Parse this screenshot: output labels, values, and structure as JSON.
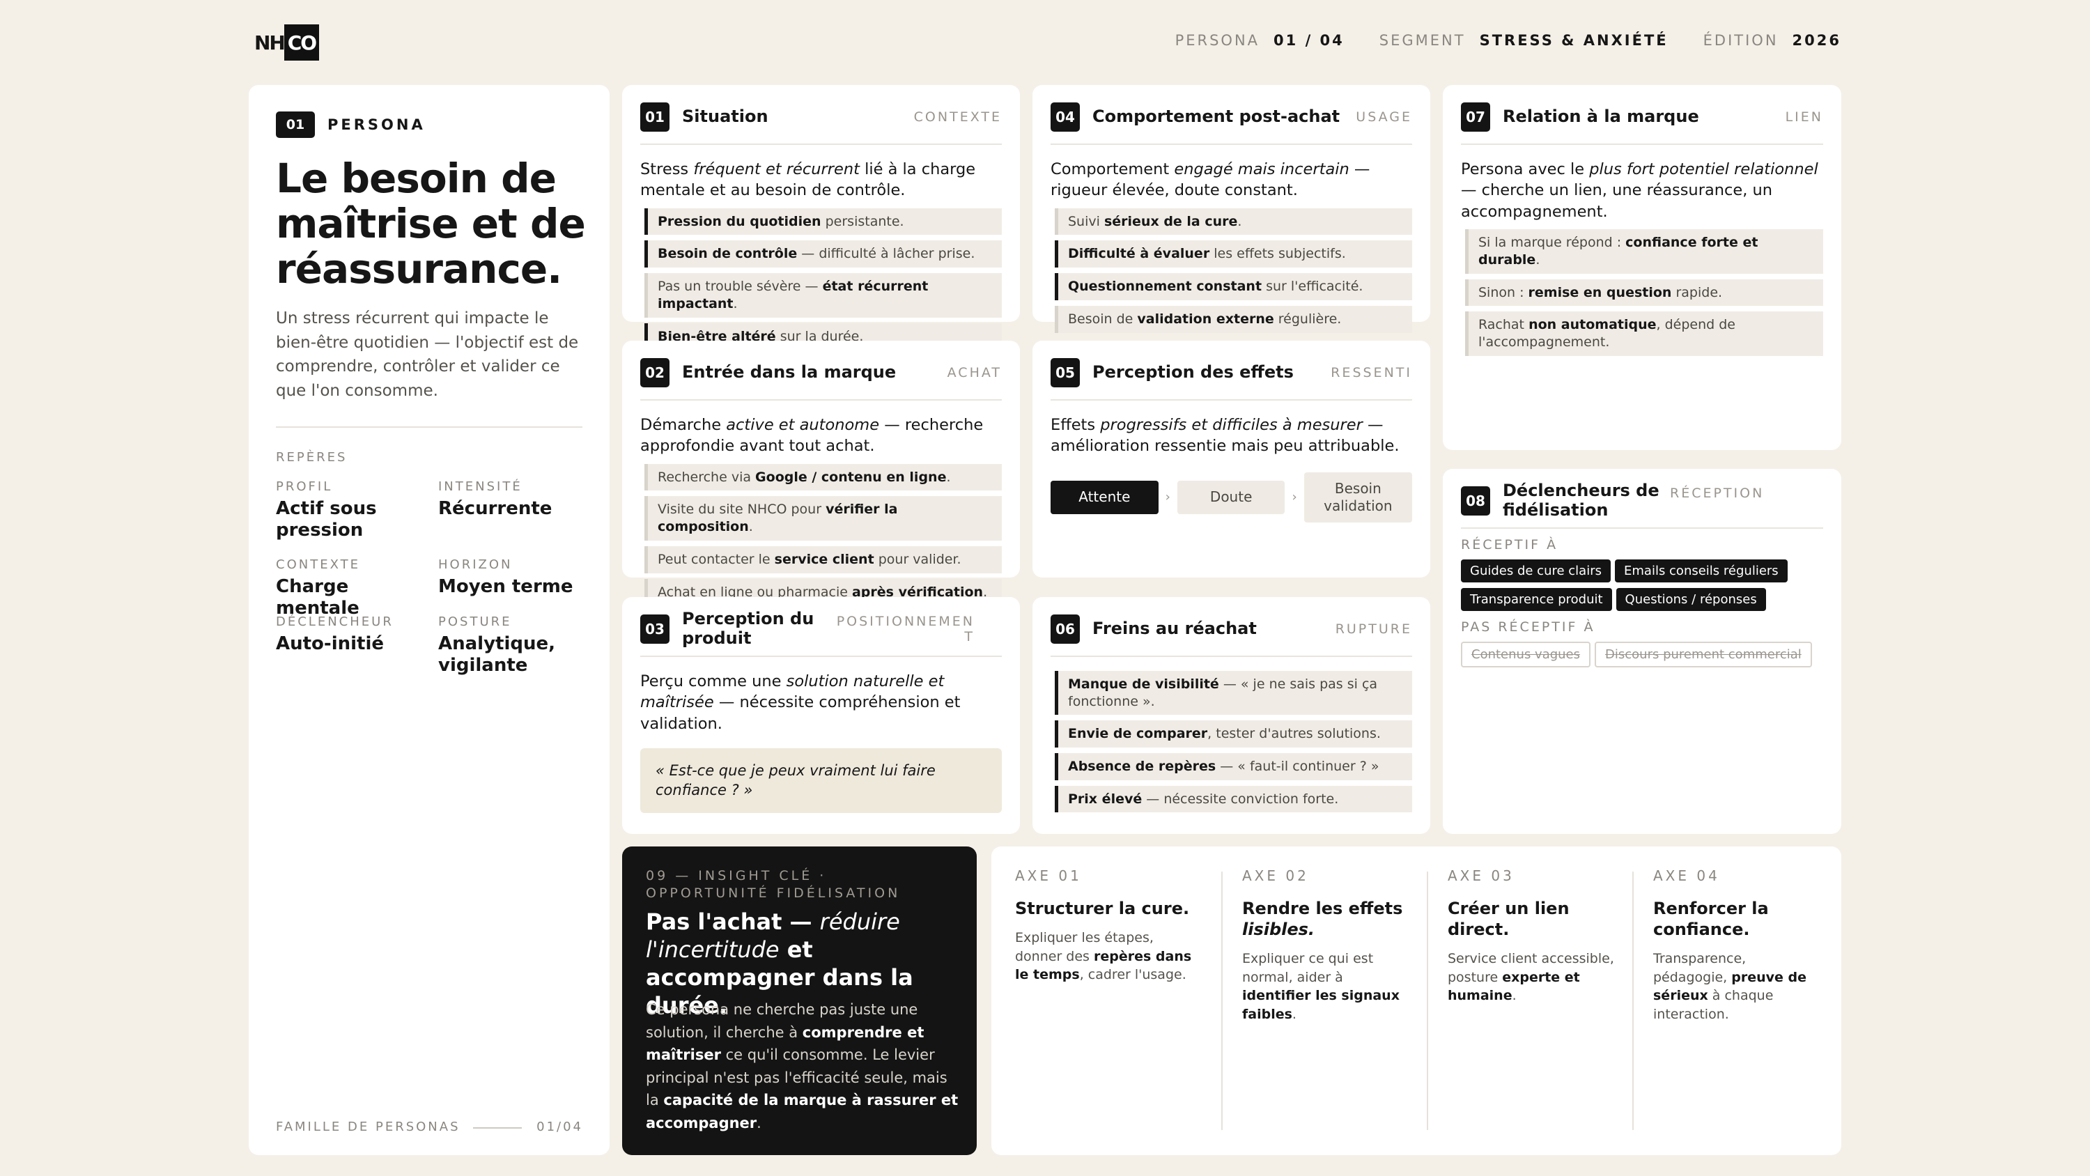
{
  "brand": {
    "logo_left": "NH",
    "logo_right": "CO"
  },
  "meta": {
    "persona_k": "PERSONA",
    "persona_v": "01 / 04",
    "segment_k": "SEGMENT",
    "segment_v": "STRESS & ANXIÉTÉ",
    "edition_k": "ÉDITION",
    "edition_v": "2026"
  },
  "persona": {
    "num": "01",
    "label": "PERSONA",
    "title": "Le besoin de maîtrise et de réassurance.",
    "desc": "Un stress récurrent qui impacte le bien-être quotidien — l'objectif est de comprendre, contrôler et valider ce que l'on consomme.",
    "reperes": "REPÈRES",
    "fields": [
      {
        "k": "PROFIL",
        "v": "Actif sous pression"
      },
      {
        "k": "INTENSITÉ",
        "v": "Récurrente"
      },
      {
        "k": "CONTEXTE",
        "v": "Charge mentale"
      },
      {
        "k": "HORIZON",
        "v": "Moyen terme"
      },
      {
        "k": "DÉCLENCHEUR",
        "v": "Auto-initié"
      },
      {
        "k": "POSTURE",
        "v": "Analytique, vigilante"
      }
    ],
    "footer_k": "FAMILLE DE PERSONAS",
    "footer_v": "01/04"
  },
  "c01": {
    "num": "01",
    "title": "Situation",
    "tag": "CONTEXTE",
    "lead_a": "Stress ",
    "lead_i": "fréquent et récurrent",
    "lead_b": " lié à la charge mentale et au besoin de contrôle.",
    "items": [
      {
        "b": "Pression du quotidien",
        "t": " persistante.",
        "b2": "",
        "t2": ""
      },
      {
        "b": "Besoin de contrôle",
        "t": " — difficulté à lâcher prise.",
        "b2": "",
        "t2": ""
      },
      {
        "b": "",
        "t": "Pas un trouble sévère — ",
        "b2": "état récurrent impactant",
        "t2": "."
      },
      {
        "b": "Bien-être altéré",
        "t": " sur la durée.",
        "b2": "",
        "t2": ""
      }
    ]
  },
  "c02": {
    "num": "02",
    "title": "Entrée dans la marque",
    "tag": "ACHAT",
    "lead_a": "Démarche ",
    "lead_i": "active et autonome",
    "lead_b": " — recherche approfondie avant tout achat.",
    "items": [
      {
        "b": "",
        "t": "Recherche via ",
        "b2": "Google / contenu en ligne",
        "t2": "."
      },
      {
        "b": "",
        "t": "Visite du site NHCO pour ",
        "b2": "vérifier la composition",
        "t2": "."
      },
      {
        "b": "",
        "t": "Peut contacter le ",
        "b2": "service client",
        "t2": " pour valider."
      },
      {
        "b": "",
        "t": "Achat en ligne ou pharmacie ",
        "b2": "après vérification",
        "t2": "."
      }
    ]
  },
  "c03": {
    "num": "03",
    "title": "Perception du produit",
    "tag": "POSITIONNEMENT",
    "lead_a": "Perçu comme une ",
    "lead_i": "solution naturelle et maîtrisée",
    "lead_b": " — nécessite compréhension et validation.",
    "quote": "« Est-ce que je peux vraiment lui faire confiance ? »"
  },
  "c04": {
    "num": "04",
    "title": "Comportement post-achat",
    "tag": "USAGE",
    "lead_a": "Comportement ",
    "lead_i": "engagé mais incertain",
    "lead_b": " — rigueur élevée, doute constant.",
    "items": [
      {
        "b": "",
        "t": "Suivi ",
        "b2": "sérieux de la cure",
        "t2": "."
      },
      {
        "b": "Difficulté à évaluer",
        "t": " les effets subjectifs.",
        "b2": "",
        "t2": ""
      },
      {
        "b": "Questionnement constant",
        "t": " sur l'efficacité.",
        "b2": "",
        "t2": ""
      },
      {
        "b": "",
        "t": "Besoin de ",
        "b2": "validation externe",
        "t2": " régulière."
      }
    ]
  },
  "c05": {
    "num": "05",
    "title": "Perception des effets",
    "tag": "RESSENTI",
    "lead_a": "Effets ",
    "lead_i": "progressifs et difficiles à mesurer",
    "lead_b": " — amélioration ressentie mais peu attribuable.",
    "steps": [
      "Attente",
      "Doute",
      "Besoin validation"
    ],
    "arrow": "›"
  },
  "c06": {
    "num": "06",
    "title": "Freins au réachat",
    "tag": "RUPTURE",
    "items": [
      {
        "b": "Manque de visibilité",
        "t": " — « je ne sais pas si ça fonctionne ».",
        "b2": "",
        "t2": ""
      },
      {
        "b": "Envie de comparer",
        "t": ", tester d'autres solutions.",
        "b2": "",
        "t2": ""
      },
      {
        "b": "Absence de repères",
        "t": " — « faut-il continuer ? »",
        "b2": "",
        "t2": ""
      },
      {
        "b": "Prix élevé",
        "t": " — nécessite conviction forte.",
        "b2": "",
        "t2": ""
      }
    ]
  },
  "c07": {
    "num": "07",
    "title": "Relation à la marque",
    "tag": "LIEN",
    "lead_a": "Persona avec le ",
    "lead_i": "plus fort potentiel relationnel",
    "lead_b": " — cherche un lien, une réassurance, un accompagnement.",
    "items": [
      {
        "b": "",
        "t": "Si la marque répond : ",
        "b2": "confiance forte et durable",
        "t2": "."
      },
      {
        "b": "",
        "t": "Sinon : ",
        "b2": "remise en question",
        "t2": " rapide."
      },
      {
        "b": "",
        "t": "Rachat ",
        "b2": "non automatique",
        "t2": ", dépend de l'accompagnement."
      }
    ]
  },
  "c08": {
    "num": "08",
    "title": "Déclencheurs de fidélisation",
    "tag": "RÉCEPTION",
    "recept_label": "RÉCEPTIF À",
    "recept": [
      "Guides de cure clairs",
      "Emails conseils réguliers",
      "Transparence produit",
      "Questions / réponses"
    ],
    "nonrecept_label": "PAS RÉCEPTIF À",
    "nonrecept": [
      "Contenus vagues",
      "Discours purement commercial"
    ]
  },
  "insight": {
    "kicker": "09 — INSIGHT CLÉ · OPPORTUNITÉ FIDÉLISATION",
    "h_a": "Pas l'achat — ",
    "h_i": "réduire l'incertitude",
    "h_b": " et accompagner dans la durée.",
    "p1": "Ce persona ne cherche pas juste une solution, il cherche à ",
    "p1b": "comprendre et maîtriser",
    "p2": " ce qu'il consomme. Le levier principal n'est pas l'efficacité seule, mais la ",
    "p2b": "capacité de la marque à rassurer et accompagner",
    "p3": "."
  },
  "axes": [
    {
      "k": "AXE 01",
      "t": "Structurer la cure.",
      "ti": "",
      "d1": "Expliquer les étapes, donner des ",
      "db": "repères dans le temps",
      "d2": ", cadrer l'usage."
    },
    {
      "k": "AXE 02",
      "t": "Rendre les effets ",
      "ti": "lisibles.",
      "d1": "Expliquer ce qui est normal, aider à ",
      "db": "identifier les signaux faibles",
      "d2": "."
    },
    {
      "k": "AXE 03",
      "t": "Créer un lien direct.",
      "ti": "",
      "d1": "Service client accessible, posture ",
      "db": "experte et humaine",
      "d2": "."
    },
    {
      "k": "AXE 04",
      "t": "Renforcer la confiance.",
      "ti": "",
      "d1": "Transparence, pédagogie, ",
      "db": "preuve de sérieux",
      "d2": " à chaque interaction."
    }
  ]
}
